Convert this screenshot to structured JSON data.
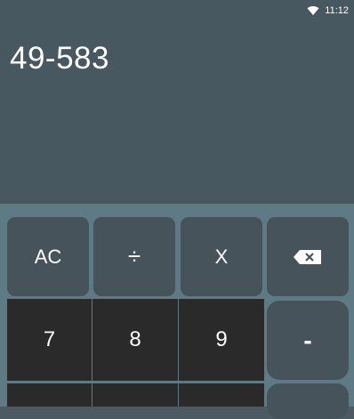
{
  "status_bar": {
    "time": "11:12",
    "wifi_icon": "wifi-icon"
  },
  "display": {
    "expression": "49-583"
  },
  "keys": {
    "ac": "AC",
    "divide": "÷",
    "multiply": "X",
    "backspace_icon": "backspace-icon",
    "seven": "7",
    "eight": "8",
    "nine": "9",
    "minus": "-"
  },
  "colors": {
    "display_bg": "#485861",
    "keypad_bg": "#5e7a85",
    "function_key": "#46535b",
    "digit_key": "#2a2a2a",
    "text": "#ffffff"
  }
}
